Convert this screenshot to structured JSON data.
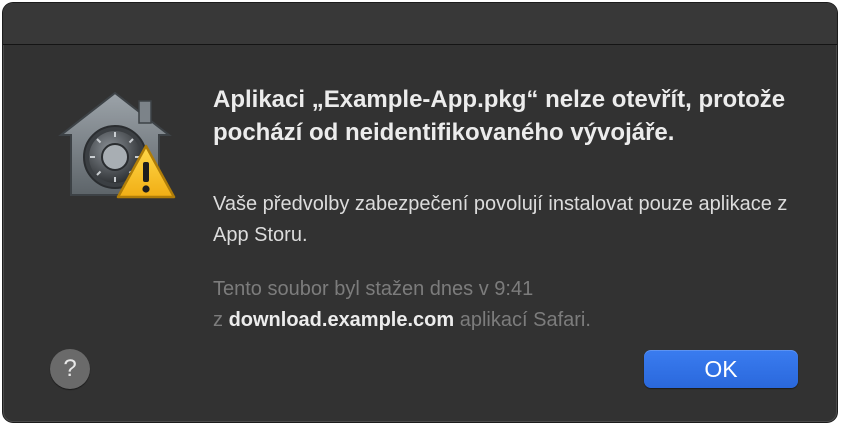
{
  "dialog": {
    "title": "Aplikaci „Example-App.pkg“ nelze otevřít, protože pochází od neidentifikovaného vývojáře.",
    "message": "Vaše předvolby zabezpečení povolují instalovat pouze aplikace z App Storu.",
    "info_prefix": "Tento soubor byl stažen dnes v 9:41",
    "info_from": "z",
    "info_domain": "download.example.com",
    "info_suffix": "aplikací Safari."
  },
  "buttons": {
    "help_label": "?",
    "ok_label": "OK"
  },
  "icons": {
    "app_icon": "gatekeeper-security-icon",
    "badge_icon": "warning-triangle-icon"
  },
  "colors": {
    "dialog_background": "#323232",
    "accent_button": "#2f6fe6",
    "info_text": "#7c7c7c"
  }
}
